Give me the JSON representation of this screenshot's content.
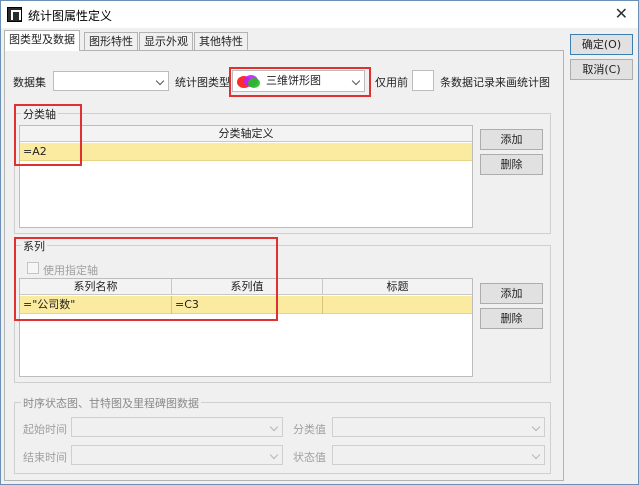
{
  "window": {
    "title": "统计图属性定义",
    "close_glyph": "✕"
  },
  "tabs": [
    {
      "label": "图类型及数据",
      "active": true
    },
    {
      "label": "图形特性",
      "active": false
    },
    {
      "label": "显示外观",
      "active": false
    },
    {
      "label": "其他特性",
      "active": false
    }
  ],
  "side_buttons": {
    "ok": "确定(O)",
    "cancel": "取消(C)"
  },
  "top_row": {
    "dataset_label": "数据集",
    "dataset_value": "",
    "chart_type_label": "统计图类型",
    "chart_type_value": "三维饼形图",
    "use_first_label": "仅用前",
    "records_label": "条数据记录来画统计图"
  },
  "category_axis": {
    "title": "分类轴",
    "column_header": "分类轴定义",
    "row_value": "=A2",
    "add_button": "添加",
    "delete_button": "删除"
  },
  "series": {
    "title": "系列",
    "use_axis_label": "使用指定轴",
    "columns": [
      "系列名称",
      "系列值",
      "标题"
    ],
    "row": [
      "=\"公司数\"",
      "=C3",
      ""
    ],
    "add_button": "添加",
    "delete_button": "删除"
  },
  "timeline": {
    "title": "时序状态图、甘特图及里程碑图数据",
    "start_time_label": "起始时间",
    "end_time_label": "结束时间",
    "category_label": "分类值",
    "status_label": "状态值"
  },
  "colors": {
    "selected_row": "#fbeba0",
    "highlight": "#e03030"
  }
}
